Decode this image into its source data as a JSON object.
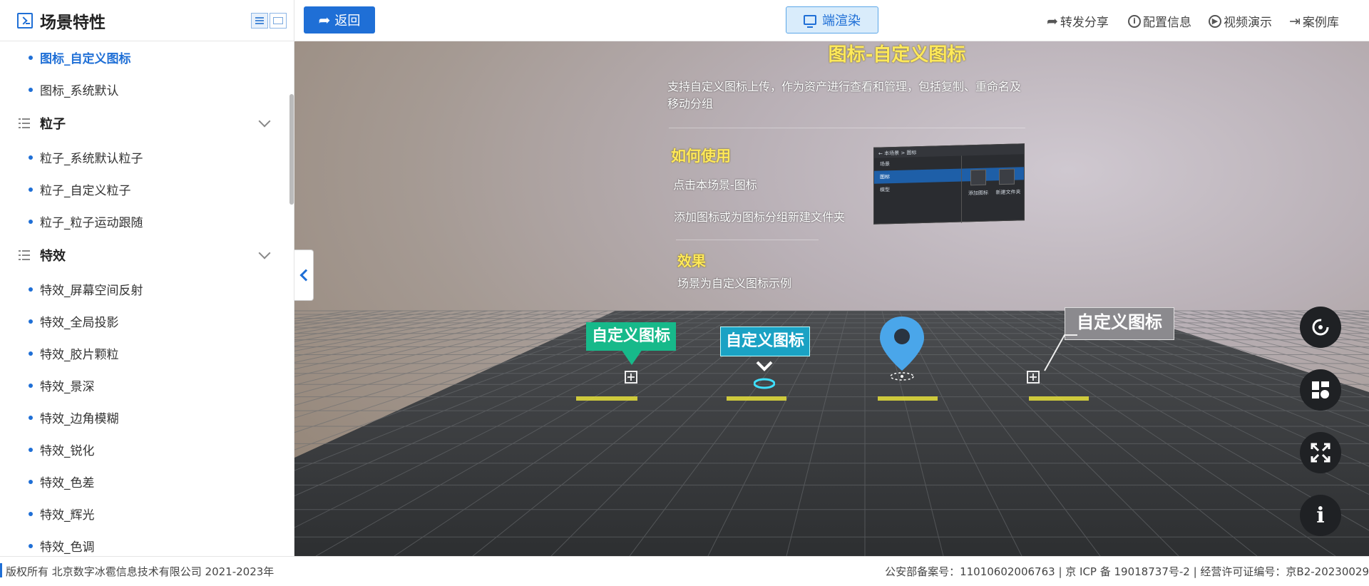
{
  "sidebar": {
    "title": "场景特性",
    "items": [
      {
        "kind": "item",
        "label": "图标_自定义图标",
        "active": true
      },
      {
        "kind": "item",
        "label": "图标_系统默认"
      },
      {
        "kind": "group",
        "label": "粒子"
      },
      {
        "kind": "item",
        "label": "粒子_系统默认粒子"
      },
      {
        "kind": "item",
        "label": "粒子_自定义粒子"
      },
      {
        "kind": "item",
        "label": "粒子_粒子运动跟随"
      },
      {
        "kind": "group",
        "label": "特效"
      },
      {
        "kind": "item",
        "label": "特效_屏幕空间反射"
      },
      {
        "kind": "item",
        "label": "特效_全局投影"
      },
      {
        "kind": "item",
        "label": "特效_胶片颗粒"
      },
      {
        "kind": "item",
        "label": "特效_景深"
      },
      {
        "kind": "item",
        "label": "特效_边角模糊"
      },
      {
        "kind": "item",
        "label": "特效_锐化"
      },
      {
        "kind": "item",
        "label": "特效_色差"
      },
      {
        "kind": "item",
        "label": "特效_辉光"
      },
      {
        "kind": "item",
        "label": "特效_色调"
      }
    ]
  },
  "toolbar": {
    "back_label": "返回",
    "render_label": "端渲染",
    "share_label": "转发分享",
    "config_label": "配置信息",
    "video_label": "视频演示",
    "cases_label": "案例库"
  },
  "scene": {
    "title": "图标-自定义图标",
    "description": "支持自定义图标上传，作为资产进行查看和管理，包括复制、重命名及移动分组",
    "how_to_heading": "如何使用",
    "step1": "点击本场景-图标",
    "step2": "添加图标或为图标分组新建文件夹",
    "effect_heading": "效果",
    "effect_text": "场景为自定义图标示例",
    "mini_screenshot": {
      "breadcrumb": "← 本场景 > 图标",
      "rows": [
        "场景",
        "图标",
        "模型"
      ],
      "buttons": [
        "添加图标",
        "新建文件夹"
      ]
    },
    "tags": [
      "自定义图标",
      "自定义图标",
      "自定义图标"
    ]
  },
  "footer": {
    "copyright": "版权所有 北京数字冰雹信息技术有限公司 2021-2023年",
    "beian": "公安部备案号：11010602006763 | 京 ICP 备 19018737号-2 | 经营许可证编号：京B2-20230029"
  },
  "colors": {
    "brand": "#1f6fd6",
    "accent_yellow": "#ffe95a",
    "tag_green": "#17b98a",
    "tag_teal": "#1aa2c4",
    "pin_blue": "#4aa6ea"
  }
}
